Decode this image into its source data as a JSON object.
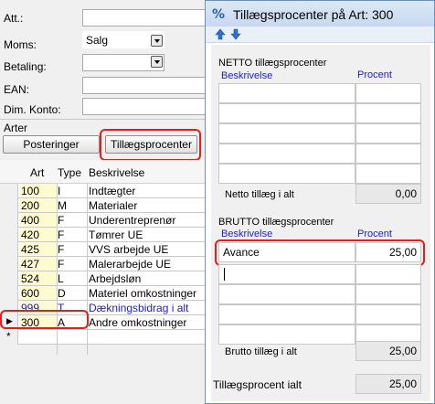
{
  "form": {
    "att_label": "Att.:",
    "moms_label": "Moms:",
    "moms_value": "Salg",
    "betaling_label": "Betaling:",
    "ean_label": "EAN:",
    "dimkonto_label": "Dim. Konto:",
    "arter_label": "Arter",
    "posteringer_button": "Posteringer",
    "tillaeg_button": "Tillægsprocenter"
  },
  "grid": {
    "headers": [
      "Art",
      "Type",
      "Beskrivelse"
    ],
    "rows": [
      {
        "art": "100",
        "type": "I",
        "desc": "Indtægter"
      },
      {
        "art": "200",
        "type": "M",
        "desc": "Materialer"
      },
      {
        "art": "400",
        "type": "F",
        "desc": "Underentreprenør"
      },
      {
        "art": "420",
        "type": "F",
        "desc": "Tømrer UE"
      },
      {
        "art": "425",
        "type": "F",
        "desc": "VVS arbejde UE"
      },
      {
        "art": "427",
        "type": "F",
        "desc": "Malerarbejde UE"
      },
      {
        "art": "524",
        "type": "L",
        "desc": "Arbejdsløn"
      },
      {
        "art": "600",
        "type": "D",
        "desc": "Materiel omkostninger"
      },
      {
        "art": "999",
        "type": "T",
        "desc": "Dækningsbidrag i alt"
      },
      {
        "art": "300",
        "type": "A",
        "desc": "Andre omkostninger"
      }
    ],
    "new_row_marker": "*",
    "current_row_marker": "▶"
  },
  "dialog": {
    "title": "Tillægsprocenter på Art: 300",
    "netto": {
      "group_title": "NETTO tillægsprocenter",
      "col_desc": "Beskrivelse",
      "col_pct": "Procent",
      "total_label": "Netto tillæg i alt",
      "total_value": "0,00"
    },
    "brutto": {
      "group_title": "BRUTTO tillægsprocenter",
      "col_desc": "Beskrivelse",
      "col_pct": "Procent",
      "row1_desc": "Avance",
      "row1_pct": "25,00",
      "total_label": "Brutto tillæg i alt",
      "total_value": "25,00"
    },
    "grand_total_label": "Tillægsprocent  ialt",
    "grand_total_value": "25,00"
  },
  "colors": {
    "highlight": "#e0201e",
    "link_blue": "#1a1ae6",
    "art_cell_bg": "#fffbd0"
  }
}
